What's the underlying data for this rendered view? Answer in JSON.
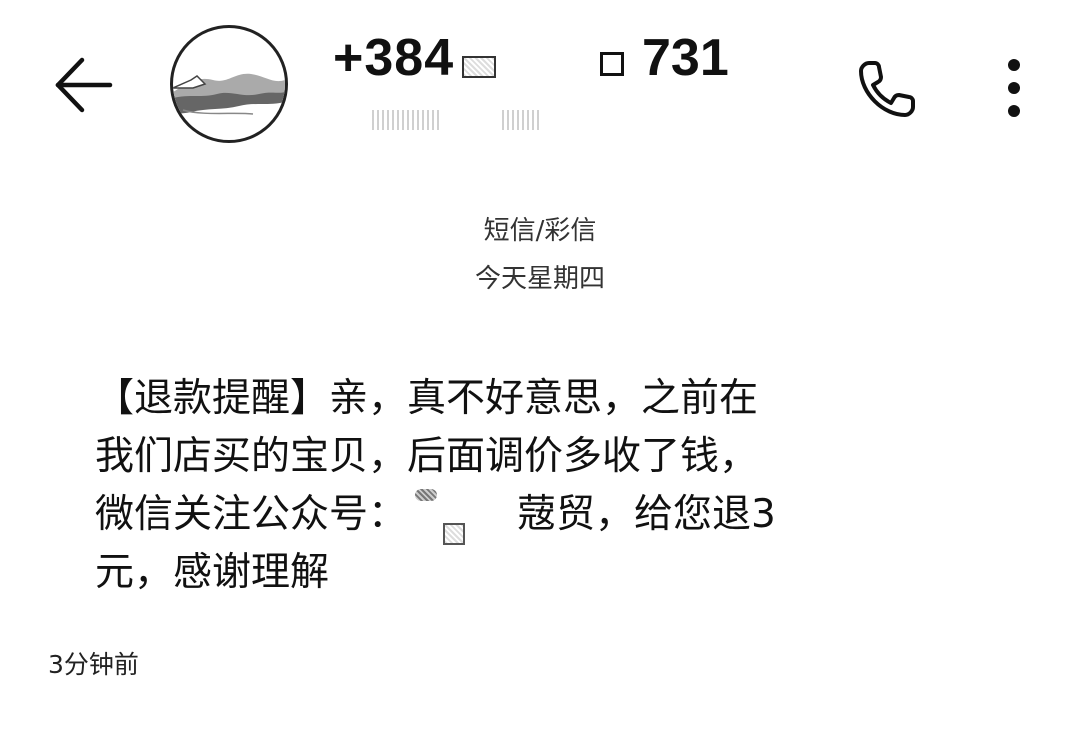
{
  "header": {
    "number_prefix": "+384",
    "number_suffix": "731",
    "back_icon": "arrow-left-icon",
    "call_icon": "phone-icon",
    "more_icon": "more-vertical-icon"
  },
  "conversation": {
    "channel_label": "短信/彩信",
    "day_label": "今天星期四"
  },
  "message": {
    "line1": "【退款提醒】亲，真不好意思，之前在",
    "line2": "我们店买的宝贝，后面调价多收了钱，",
    "line3_before": "微信关注公众号：",
    "line3_after": "䓻贸，给您退3",
    "line4": "元，感谢理解",
    "timestamp": "3分钟前"
  }
}
